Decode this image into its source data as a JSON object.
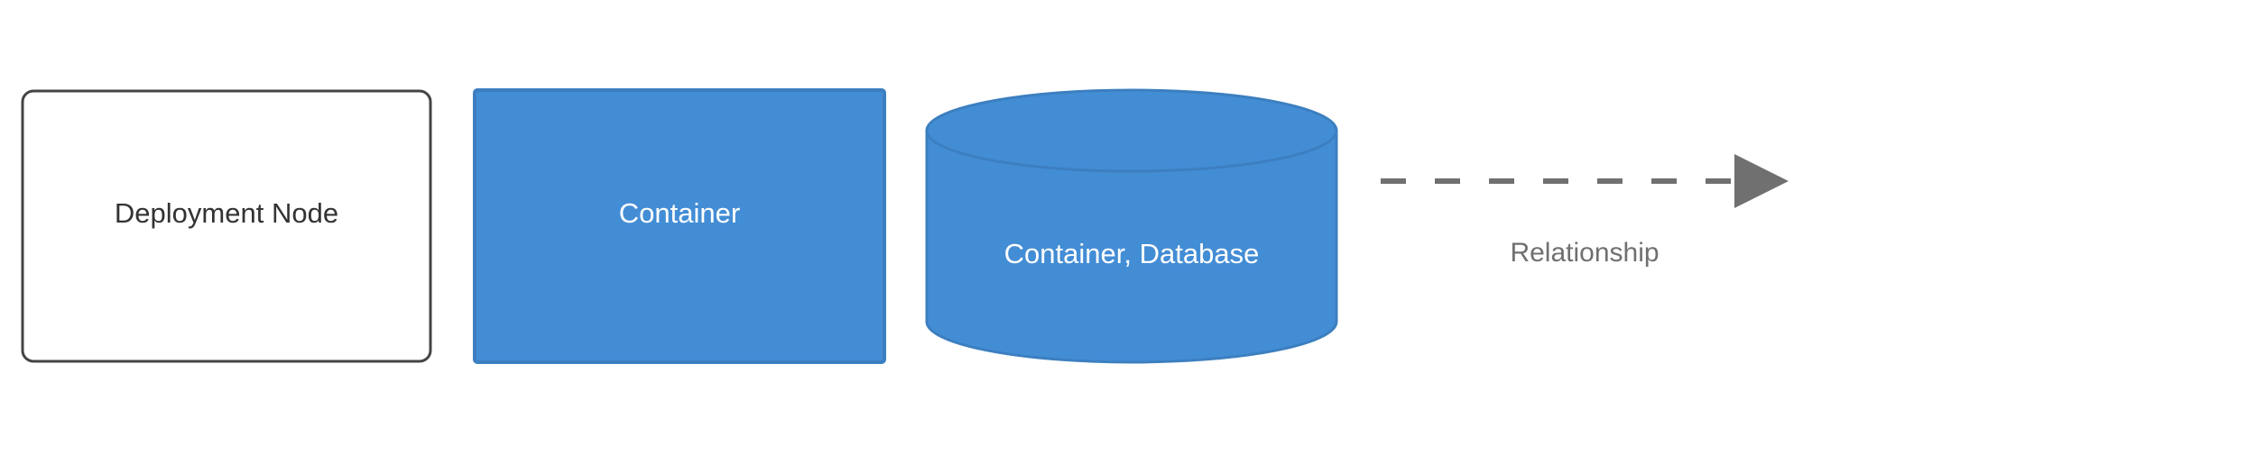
{
  "legend": {
    "deployment_node": {
      "label": "Deployment Node",
      "border_color": "#444444",
      "fill_color": "#ffffff",
      "text_color": "#333333"
    },
    "container": {
      "label": "Container",
      "fill_color": "#438dd5",
      "border_color": "#3c7fc0",
      "text_color": "#ffffff"
    },
    "container_database": {
      "label": "Container, Database",
      "fill_color": "#438dd5",
      "border_color": "#3c7fc0",
      "text_color": "#ffffff"
    },
    "relationship": {
      "label": "Relationship",
      "line_color": "#707070",
      "text_color": "#707070",
      "line_style": "dashed"
    }
  }
}
